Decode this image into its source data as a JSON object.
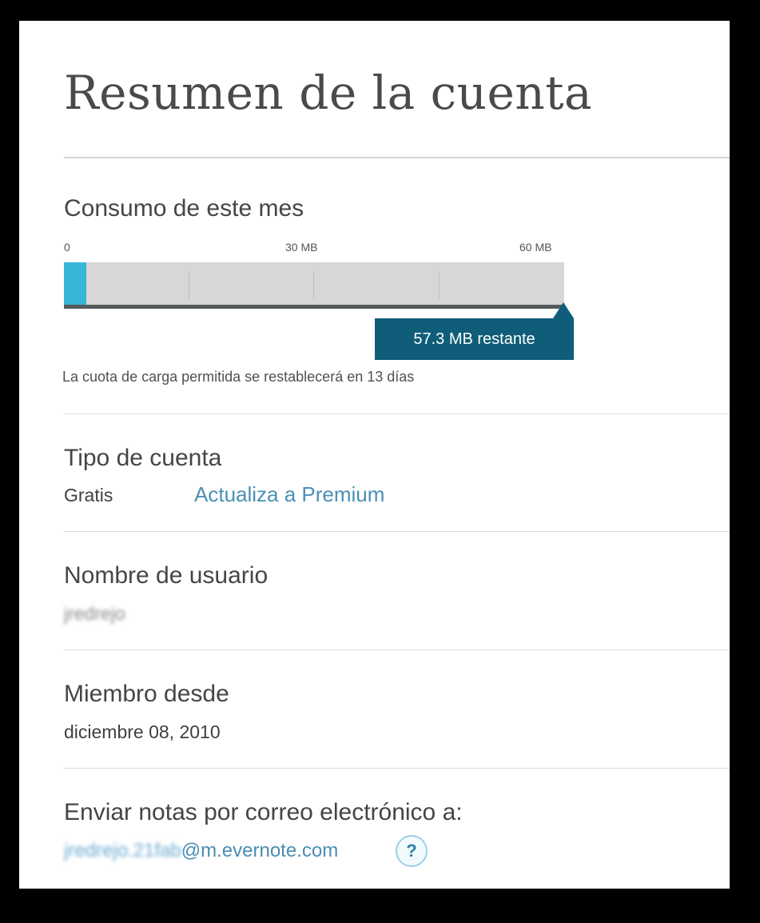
{
  "page": {
    "title": "Resumen de la cuenta"
  },
  "usage": {
    "label": "Consumo de este mes",
    "scale": [
      "0",
      "30 MB",
      "60 MB"
    ],
    "used_fraction": 0.045,
    "remaining_label": "57.3 MB restante",
    "reset_note": "La cuota de carga permitida se restablecerá en 13 días",
    "colors": {
      "fill": "#38b6d8",
      "track": "#d7d7d7",
      "tooltip": "#0f5d78"
    }
  },
  "account_type": {
    "label": "Tipo de cuenta",
    "value": "Gratis",
    "upgrade_link": "Actualiza a Premium"
  },
  "username": {
    "label": "Nombre de usuario",
    "value": "jredrejo"
  },
  "member_since": {
    "label": "Miembro desde",
    "value": "diciembre 08, 2010"
  },
  "email_notes": {
    "label": "Enviar notas por correo electrónico a:",
    "address_local": "jredrejo.21fab",
    "address_domain": "@m.evernote.com",
    "help_glyph": "?"
  }
}
